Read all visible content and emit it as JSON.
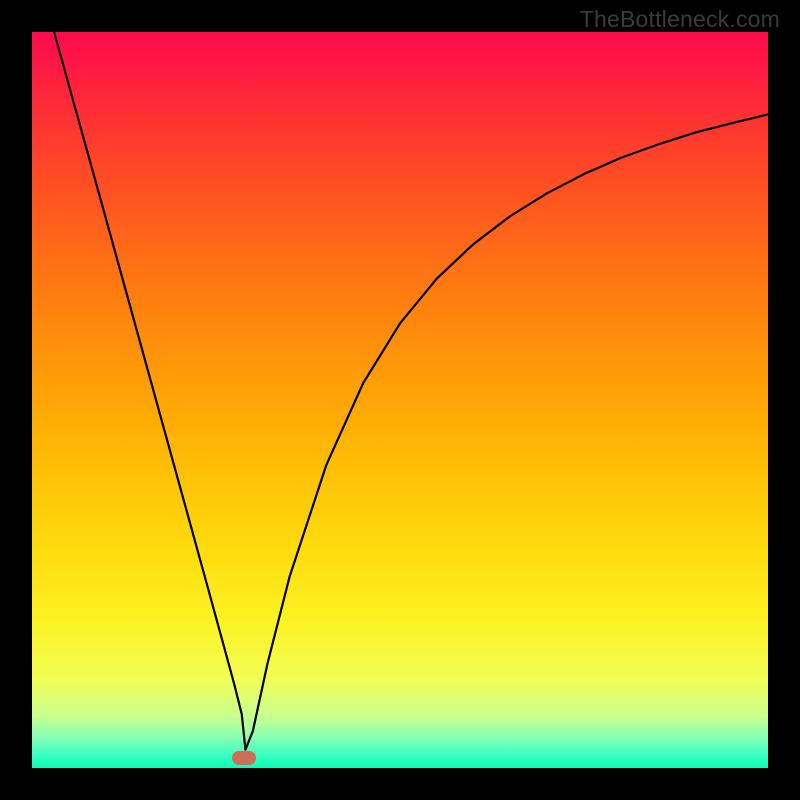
{
  "watermark": "TheBottleneck.com",
  "chart_data": {
    "type": "line",
    "title": "",
    "xlabel": "",
    "ylabel": "",
    "xlim": [
      0,
      100
    ],
    "ylim": [
      0,
      100
    ],
    "grid": false,
    "legend": false,
    "series": [
      {
        "name": "curve",
        "x": [
          3,
          5,
          10,
          15,
          20,
          24,
          26,
          27.5,
          28.5,
          29,
          30,
          32,
          35,
          40,
          45,
          50,
          55,
          60,
          65,
          70,
          75,
          80,
          85,
          90,
          95,
          100
        ],
        "values": [
          100,
          92.8,
          74.8,
          56.7,
          38.6,
          24.1,
          16.8,
          11.3,
          7.3,
          2.5,
          5.0,
          14.2,
          26.0,
          41.2,
          52.3,
          60.4,
          66.5,
          71.2,
          75.0,
          78.1,
          80.7,
          82.9,
          84.7,
          86.3,
          87.6,
          88.8
        ]
      }
    ],
    "marker": {
      "x": 28.8,
      "y": 1.3
    },
    "colors": {
      "curve": "#000000",
      "marker": "#cc6e5a"
    }
  }
}
